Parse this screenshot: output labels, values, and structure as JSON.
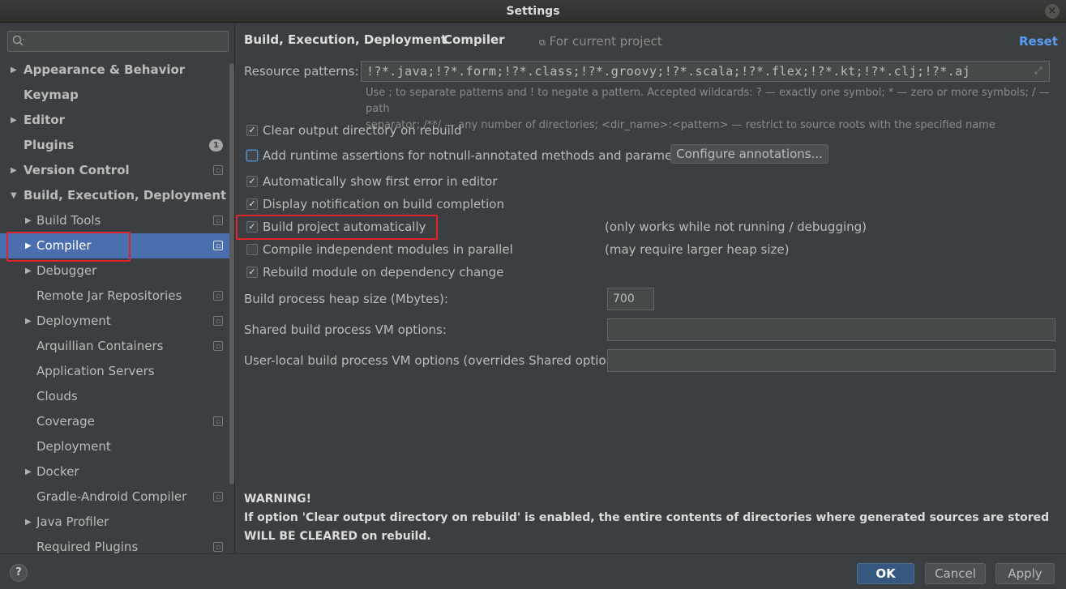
{
  "window": {
    "title": "Settings",
    "close": "×"
  },
  "sidebar": {
    "search_placeholder": "",
    "items": [
      {
        "label": "Appearance & Behavior",
        "arrow": "▶",
        "bold": true
      },
      {
        "label": "Keymap",
        "arrow": "",
        "bold": true
      },
      {
        "label": "Editor",
        "arrow": "▶",
        "bold": true
      },
      {
        "label": "Plugins",
        "arrow": "",
        "bold": true,
        "badge": "1"
      },
      {
        "label": "Version Control",
        "arrow": "▶",
        "bold": true,
        "project_icon": true
      },
      {
        "label": "Build, Execution, Deployment",
        "arrow": "▼",
        "bold": true
      },
      {
        "label": "Build Tools",
        "arrow": "▶",
        "project_icon": true
      },
      {
        "label": "Compiler",
        "arrow": "▶",
        "project_icon": true,
        "selected": true
      },
      {
        "label": "Debugger",
        "arrow": "▶"
      },
      {
        "label": "Remote Jar Repositories",
        "arrow": "",
        "project_icon": true
      },
      {
        "label": "Deployment",
        "arrow": "▶",
        "project_icon": true
      },
      {
        "label": "Arquillian Containers",
        "arrow": "",
        "project_icon": true
      },
      {
        "label": "Application Servers",
        "arrow": ""
      },
      {
        "label": "Clouds",
        "arrow": ""
      },
      {
        "label": "Coverage",
        "arrow": "",
        "project_icon": true
      },
      {
        "label": "Deployment",
        "arrow": ""
      },
      {
        "label": "Docker",
        "arrow": "▶"
      },
      {
        "label": "Gradle-Android Compiler",
        "arrow": "",
        "project_icon": true
      },
      {
        "label": "Java Profiler",
        "arrow": "▶"
      },
      {
        "label": "Required Plugins",
        "arrow": "",
        "project_icon": true
      }
    ]
  },
  "breadcrumb": {
    "parent": "Build, Execution, Deployment",
    "separator": "›",
    "current": "Compiler",
    "scope": "For current project",
    "reset": "Reset"
  },
  "resource_patterns": {
    "label": "Resource patterns:",
    "value": "!?*.java;!?*.form;!?*.class;!?*.groovy;!?*.scala;!?*.flex;!?*.kt;!?*.clj;!?*.aj",
    "hint_line1": "Use ; to separate patterns and ! to negate a pattern. Accepted wildcards: ? — exactly one symbol; * — zero or more symbols; / — path",
    "hint_line2": "separator; /**/ — any number of directories; <dir_name>:<pattern> — restrict to source roots with the specified name"
  },
  "options": [
    {
      "label": "Clear output directory on rebuild",
      "checked": true
    },
    {
      "label": "Add runtime assertions for notnull-annotated methods and parameters",
      "checked": false,
      "button": "Configure annotations..."
    },
    {
      "label": "Automatically show first error in editor",
      "checked": true
    },
    {
      "label": "Display notification on build completion",
      "checked": true
    },
    {
      "label": "Build project automatically",
      "checked": true,
      "note": "(only works while not running / debugging)"
    },
    {
      "label": "Compile independent modules in parallel",
      "checked": false,
      "note": "(may require larger heap size)"
    },
    {
      "label": "Rebuild module on dependency change",
      "checked": true
    }
  ],
  "heap": {
    "label": "Build process heap size (Mbytes):",
    "value": "700"
  },
  "shared_vm": {
    "label": "Shared build process VM options:",
    "value": ""
  },
  "user_vm": {
    "label": "User-local build process VM options (overrides Shared options):",
    "value": ""
  },
  "warning": {
    "title": "WARNING!",
    "text": "If option 'Clear output directory on rebuild' is enabled, the entire contents of directories where generated sources are stored WILL BE CLEARED on rebuild."
  },
  "footer": {
    "help": "?",
    "ok": "OK",
    "cancel": "Cancel",
    "apply": "Apply"
  },
  "colors": {
    "accent": "#4b6eaf",
    "link": "#589df6",
    "highlight": "#e0242b",
    "background": "#3c3f41"
  }
}
